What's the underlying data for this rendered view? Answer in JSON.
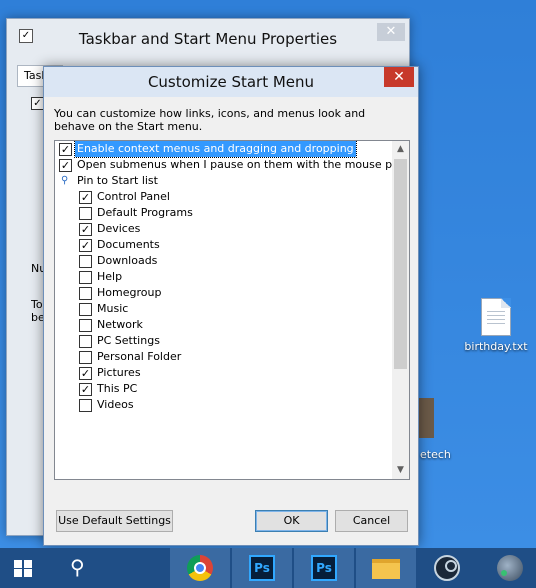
{
  "desktop": {
    "birthday_label": "birthday.txt",
    "partial_label": "etech"
  },
  "background_window": {
    "title": "Taskbar and Start Menu Properties",
    "close_glyph": "✕",
    "tab_partial": "Taskb",
    "frag_nu": "Nu",
    "frag_to": "To",
    "frag_be": "be"
  },
  "dialog": {
    "title": "Customize Start Menu",
    "close_glyph": "✕",
    "description": "You can customize how links, icons, and menus look and behave on the Start menu.",
    "options": [
      {
        "label": "Enable context menus and dragging and dropping",
        "checked": true,
        "selected": true
      },
      {
        "label": "Open submenus when I pause on them with the mouse pointer",
        "checked": true,
        "selected": false
      }
    ],
    "pin_group_label": "Pin to Start list",
    "pin_items": [
      {
        "label": "Control Panel",
        "checked": true
      },
      {
        "label": "Default Programs",
        "checked": false
      },
      {
        "label": "Devices",
        "checked": true
      },
      {
        "label": "Documents",
        "checked": true
      },
      {
        "label": "Downloads",
        "checked": false
      },
      {
        "label": "Help",
        "checked": false
      },
      {
        "label": "Homegroup",
        "checked": false
      },
      {
        "label": "Music",
        "checked": false
      },
      {
        "label": "Network",
        "checked": false
      },
      {
        "label": "PC Settings",
        "checked": false
      },
      {
        "label": "Personal Folder",
        "checked": false
      },
      {
        "label": "Pictures",
        "checked": true
      },
      {
        "label": "This PC",
        "checked": true
      },
      {
        "label": "Videos",
        "checked": false
      }
    ],
    "buttons": {
      "defaults": "Use Default Settings",
      "ok": "OK",
      "cancel": "Cancel"
    }
  },
  "taskbar": {
    "items": [
      "start",
      "search",
      "chrome",
      "photoshop",
      "photoshop",
      "file-explorer",
      "steam",
      "app"
    ],
    "ps_label": "Ps"
  }
}
